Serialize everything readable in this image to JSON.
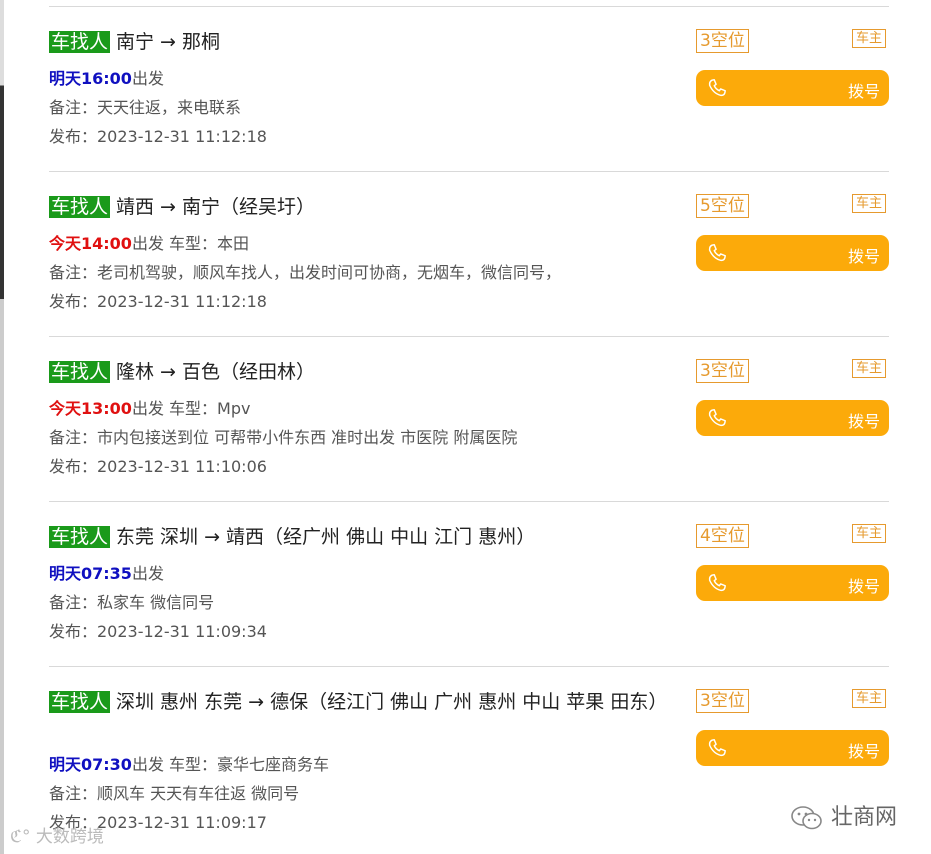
{
  "rides": [
    {
      "tag": "车找人",
      "route": "南宁 → 那桐",
      "time": "明天16:00",
      "time_color": "blue",
      "depart_suffix": "出发",
      "car_type": "",
      "note": "备注：天天往返，来电联系",
      "published": "发布：2023-12-31 11:12:18",
      "seats": "3空位",
      "role": "车主",
      "dial_label": "拨号"
    },
    {
      "tag": "车找人",
      "route": "靖西 → 南宁（经吴圩）",
      "time": "今天14:00",
      "time_color": "red",
      "depart_suffix": "出发",
      "car_type": " 车型：本田",
      "note": "备注：老司机驾驶，顺风车找人，出发时间可协商，无烟车，微信同号，",
      "published": "发布：2023-12-31 11:12:18",
      "seats": "5空位",
      "role": "车主",
      "dial_label": "拨号"
    },
    {
      "tag": "车找人",
      "route": "隆林 → 百色（经田林）",
      "time": "今天13:00",
      "time_color": "red",
      "depart_suffix": "出发",
      "car_type": " 车型：Mpv",
      "note": "备注：市内包接送到位 可帮带小件东西 准时出发 市医院 附属医院",
      "published": "发布：2023-12-31 11:10:06",
      "seats": "3空位",
      "role": "车主",
      "dial_label": "拨号"
    },
    {
      "tag": "车找人",
      "route": "东莞 深圳 → 靖西（经广州 佛山 中山 江门 惠州）",
      "time": "明天07:35",
      "time_color": "blue",
      "depart_suffix": "出发",
      "car_type": "",
      "note": "备注：私家车 微信同号",
      "published": "发布：2023-12-31 11:09:34",
      "seats": "4空位",
      "role": "车主",
      "dial_label": "拨号"
    },
    {
      "tag": "车找人",
      "route": "深圳 惠州 东莞 → 德保（经江门 佛山 广州 惠州 中山 苹果 田东）",
      "time": "明天07:30",
      "time_color": "blue",
      "depart_suffix": "出发",
      "car_type": " 车型：豪华七座商务车",
      "note": "备注：顺风车 天天有车往返 微同号",
      "published": "发布：2023-12-31 11:09:17",
      "seats": "3空位",
      "role": "车主",
      "dial_label": "拨号"
    }
  ],
  "watermark_left": "大数跨境",
  "watermark_right": "壮商网",
  "colors": {
    "tag_bg": "#1a9a1a",
    "accent": "#fcaa0a",
    "seat_border": "#e69a2e",
    "time_blue": "#1010c0",
    "time_red": "#e01010"
  }
}
